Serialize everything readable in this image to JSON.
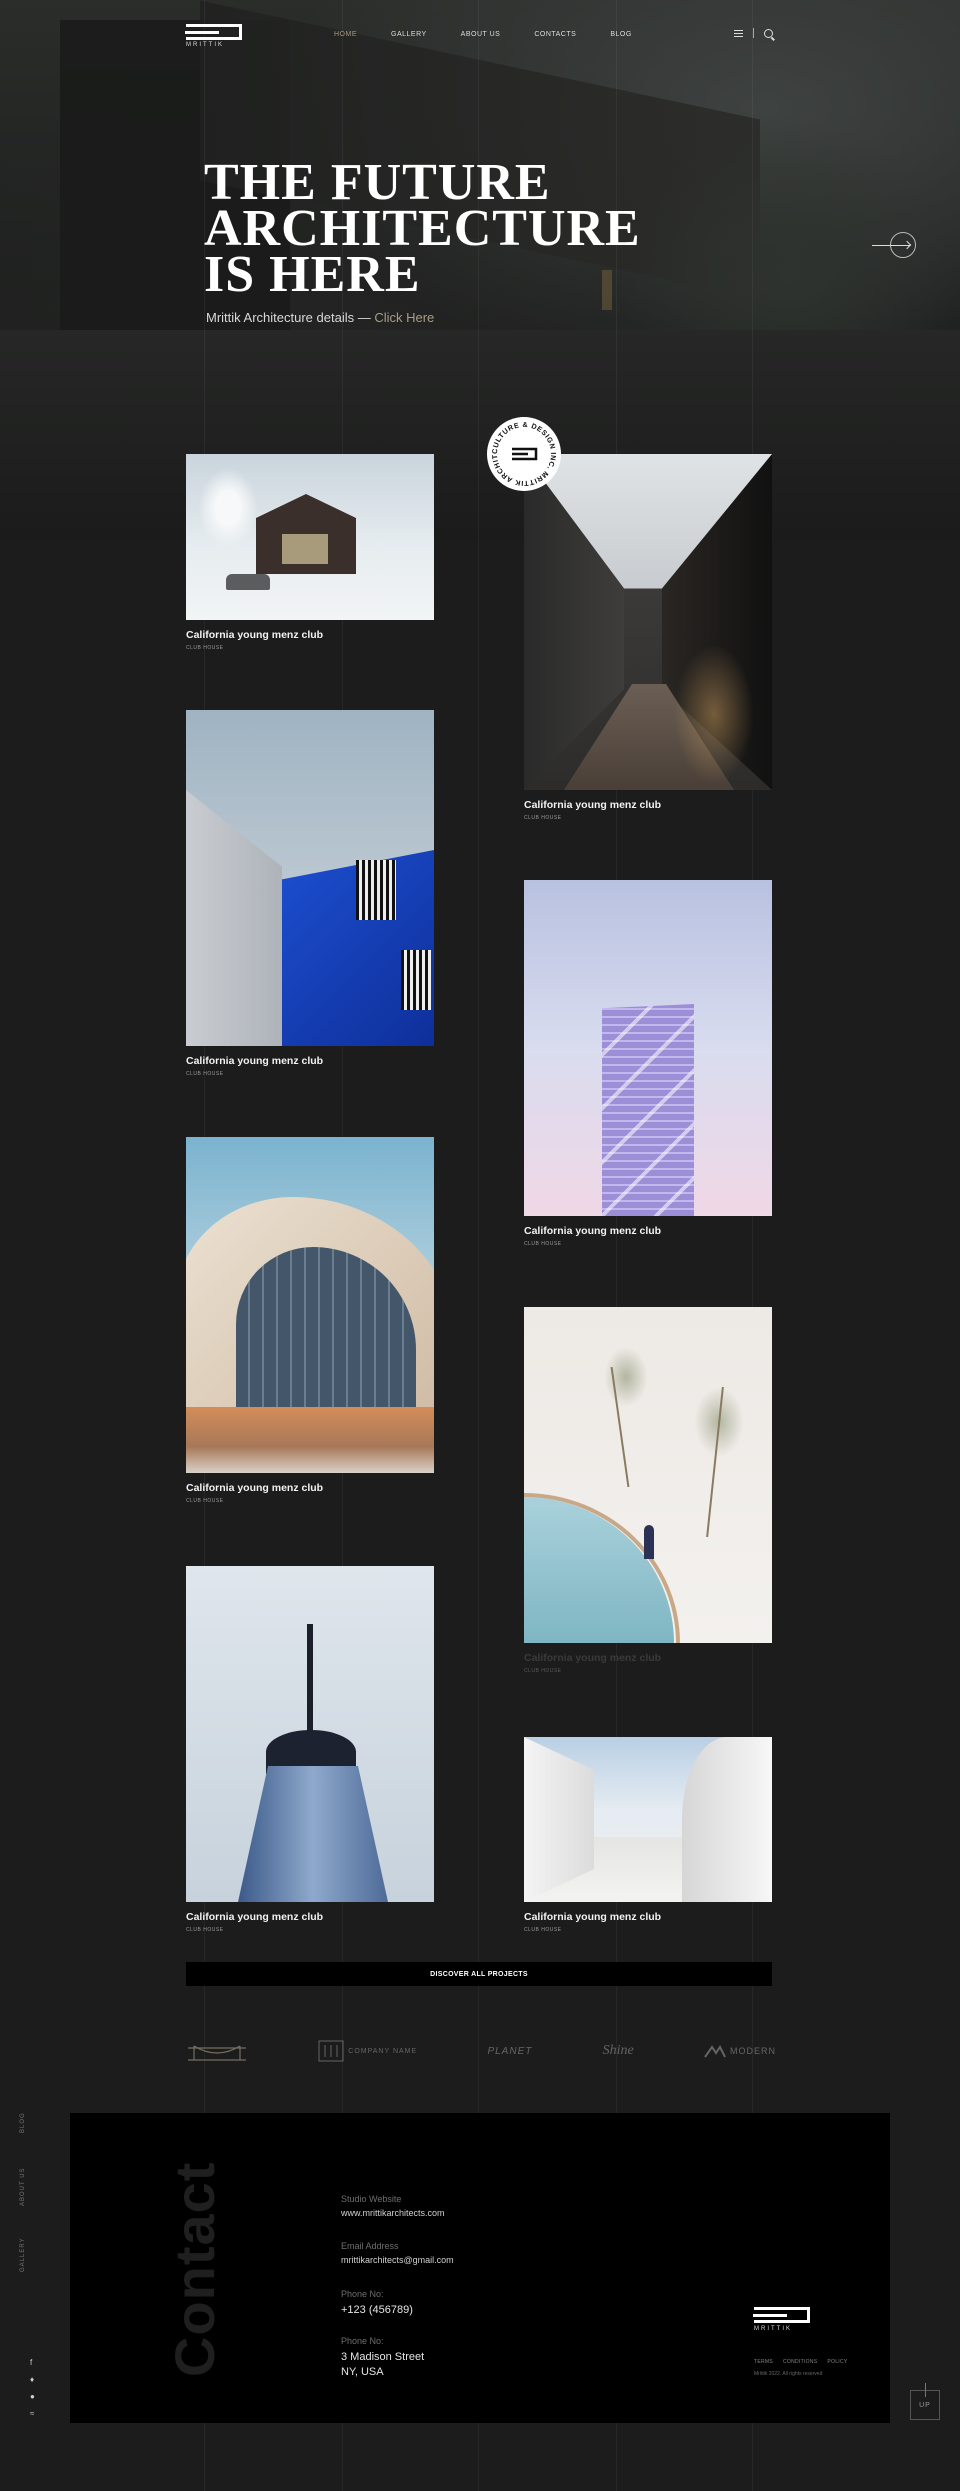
{
  "brand": {
    "name": "MRITTIK"
  },
  "nav": {
    "items": [
      "HOME",
      "GALLERY",
      "ABOUT US",
      "CONTACTS",
      "BLOG"
    ],
    "active": "HOME",
    "menu_icon": "hamburger-icon",
    "search_icon": "search-icon"
  },
  "hero": {
    "title_line1": "THE FUTURE",
    "title_line2": "ARCHITECTURE",
    "title_line3": "IS HERE",
    "subtitle": "Mrittik Architecture details — ",
    "subtitle_link": "Click Here",
    "arrow_icon": "arrow-right-icon"
  },
  "badge": {
    "text": "CULTURE & DESIGN INC. MRITTIK ARCHITECTURE "
  },
  "projects": [
    {
      "title": "California young menz club",
      "category": "CLUB HOUSE"
    },
    {
      "title": "California young menz club",
      "category": "CLUB HOUSE"
    },
    {
      "title": "California young menz club",
      "category": "CLUB HOUSE"
    },
    {
      "title": "California young menz club",
      "category": "CLUB HOUSE"
    },
    {
      "title": "California young menz club",
      "category": "CLUB HOUSE"
    },
    {
      "title": "California young menz club",
      "category": "CLUB HOUSE"
    },
    {
      "title": "California young menz club",
      "category": "CLUB HOUSE"
    },
    {
      "title": "California young menz club",
      "category": "CLUB HOUSE"
    }
  ],
  "discover_label": "DISCOVER ALL PROJECTS",
  "partners": [
    "COMPANY NAME",
    "PLANET",
    "Shine",
    "MODERN"
  ],
  "side_nav": [
    "BLOG",
    "ABOUT US",
    "GALLERY"
  ],
  "contact": {
    "heading": "Contact",
    "website_label": "Studio Website",
    "website": "www.mrittikarchitects.com",
    "email_label": "Email Address",
    "email": "mrittikarchitects@gmail.com",
    "phone_label": "Phone No:",
    "phone": "+123 (456789)",
    "address_label": "Phone No:",
    "address_line1": "3 Madison Street",
    "address_line2": "NY, USA"
  },
  "footer": {
    "links": [
      "TERMS",
      "CONDITIONS",
      "POLICY"
    ],
    "copyright": "Mrittik 2022. All rights reserved"
  },
  "socials": [
    "facebook-icon",
    "twitter-icon",
    "pinterest-icon",
    "rss-icon"
  ],
  "up_label": "UP"
}
